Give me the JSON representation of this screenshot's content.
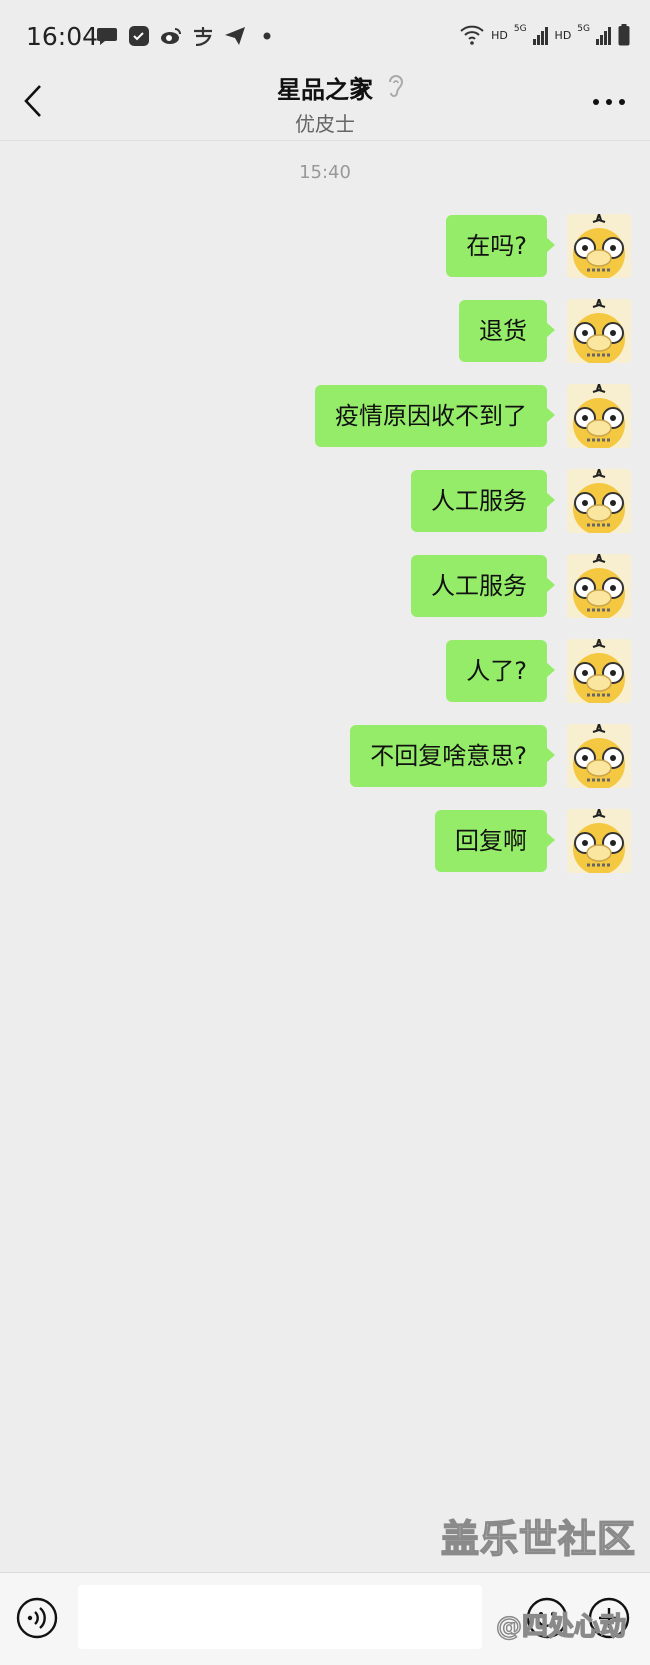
{
  "status_bar": {
    "time": "16:04",
    "left_icons": [
      "chat-bubble-icon",
      "app-badge-icon",
      "weibo-icon",
      "alipay-icon",
      "send-icon",
      "dot-icon"
    ],
    "right_labels": {
      "hd1": "HD",
      "hd2": "HD",
      "signal1": "5G",
      "signal2": "5G"
    }
  },
  "header": {
    "title": "星品之家",
    "subtitle": "优皮士"
  },
  "timestamp": "15:40",
  "messages": [
    {
      "text": "在吗?",
      "sender": "self"
    },
    {
      "text": "退货",
      "sender": "self"
    },
    {
      "text": "疫情原因收不到了",
      "sender": "self"
    },
    {
      "text": "人工服务",
      "sender": "self"
    },
    {
      "text": "人工服务",
      "sender": "self"
    },
    {
      "text": "人了?",
      "sender": "self"
    },
    {
      "text": "不回复啥意思?",
      "sender": "self"
    },
    {
      "text": "回复啊",
      "sender": "self"
    }
  ],
  "input": {
    "value": ""
  },
  "watermark": {
    "line1": "盖乐世社区",
    "line2": "@四处心动"
  },
  "colors": {
    "bubble": "#95ec69",
    "background": "#ededed",
    "avatar_yellow": "#f5c842"
  }
}
